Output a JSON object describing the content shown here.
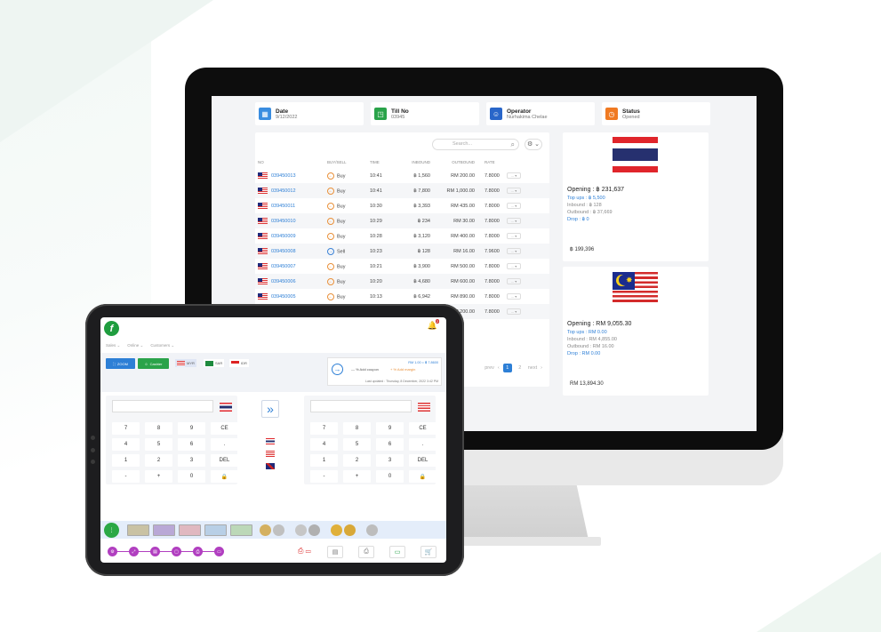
{
  "header": {
    "date": {
      "title": "Date",
      "value": "9/12/2022"
    },
    "till": {
      "title": "Till No",
      "value": "03945"
    },
    "operator": {
      "title": "Operator",
      "value": "Nurhakima Chelae"
    },
    "status": {
      "title": "Status",
      "value": "Opened"
    }
  },
  "colors": {
    "date": "#3a8de0",
    "till": "#2aa34a",
    "operator": "#2966c9",
    "status": "#f07a22",
    "accent": "#2d7fd6"
  },
  "table": {
    "search_placeholder": "Search...",
    "columns": [
      "NO",
      "BUY/SELL",
      "TIME",
      "INBOUND",
      "OUTBOUND",
      "RATE"
    ],
    "rows": [
      {
        "no": "039450013",
        "type": "Buy",
        "time": "10:41",
        "inbound": "฿ 1,560",
        "outbound": "RM 200.00",
        "rate": "7.8000"
      },
      {
        "no": "039450012",
        "type": "Buy",
        "time": "10:41",
        "inbound": "฿ 7,800",
        "outbound": "RM 1,000.00",
        "rate": "7.8000"
      },
      {
        "no": "039450011",
        "type": "Buy",
        "time": "10:30",
        "inbound": "฿ 3,393",
        "outbound": "RM 435.00",
        "rate": "7.8000"
      },
      {
        "no": "039450010",
        "type": "Buy",
        "time": "10:29",
        "inbound": "฿ 234",
        "outbound": "RM 30.00",
        "rate": "7.8000"
      },
      {
        "no": "039450009",
        "type": "Buy",
        "time": "10:28",
        "inbound": "฿ 3,120",
        "outbound": "RM 400.00",
        "rate": "7.8000"
      },
      {
        "no": "039450008",
        "type": "Sell",
        "time": "10:23",
        "inbound": "฿ 128",
        "outbound": "RM 16.00",
        "rate": "7.9600"
      },
      {
        "no": "039450007",
        "type": "Buy",
        "time": "10:21",
        "inbound": "฿ 3,900",
        "outbound": "RM 500.00",
        "rate": "7.8000"
      },
      {
        "no": "039450006",
        "type": "Buy",
        "time": "10:20",
        "inbound": "฿ 4,680",
        "outbound": "RM 600.00",
        "rate": "7.8000"
      },
      {
        "no": "039450005",
        "type": "Buy",
        "time": "10:13",
        "inbound": "฿ 6,942",
        "outbound": "RM 890.00",
        "rate": "7.8000"
      },
      {
        "no": "039450004",
        "type": "Buy",
        "time": "10:11",
        "inbound": "฿ 1,560",
        "outbound": "RM 200.00",
        "rate": "7.8000"
      }
    ],
    "action": "... ▾",
    "pager": {
      "prev": "prev",
      "pages": [
        "1",
        "2"
      ],
      "next": "next"
    }
  },
  "thb_card": {
    "opening": "Opening : ฿ 231,637",
    "topups": "Top ups : ฿ 5,500",
    "inbound": "Inbound : ฿ 128",
    "outbound": "Outbound : ฿ 37,669",
    "drop": "Drop : ฿ 0",
    "total": "฿ 199,396"
  },
  "myr_card": {
    "opening": "Opening : RM 9,055.30",
    "topups": "Top ups : RM 0.00",
    "inbound": "Inbound : RM 4,855.00",
    "outbound": "Outbound : RM 16.00",
    "drop": "Drop : RM 0.00",
    "total": "RM 13,894.30"
  },
  "tablet": {
    "logo": "f",
    "notif_count": "2",
    "nav": [
      "Sales ⌄",
      "Online ⌄",
      "Customers ⌄"
    ],
    "btn_zoom": "ZOOM",
    "btn_cashier": "Cashier",
    "chips": [
      "MYR",
      "SAR",
      "IDR"
    ],
    "rate_line": "RM 1.00 = ฿ 7.8600",
    "coupon": "— %  Add coupon",
    "margin": "+ %  Add margin",
    "updated": "Last updated : Thursday, 8 December, 2022 3:42 PM",
    "keys": [
      "7",
      "8",
      "9",
      "CE",
      "4",
      "5",
      "6",
      ".",
      "1",
      "2",
      "3",
      "DEL",
      "-",
      "+",
      "0",
      "🔒"
    ]
  }
}
